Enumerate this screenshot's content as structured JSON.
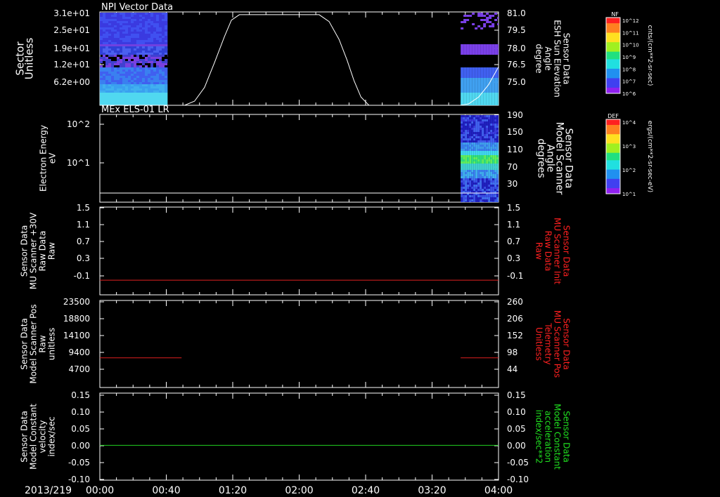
{
  "figure": {
    "date_label": "2013/219",
    "time_ticks": [
      "00:00",
      "00:40",
      "01:20",
      "02:00",
      "02:40",
      "03:20",
      "04:00"
    ],
    "time_range_hours": [
      0,
      4
    ]
  },
  "colorbars": [
    {
      "title": "NF",
      "unit_label": "cnts/(cm**2-sr-sec)",
      "tick_labels": [
        "10^12",
        "10^11",
        "10^10",
        "10^9",
        "10^8",
        "10^7",
        "10^6"
      ]
    },
    {
      "title": "DEF",
      "unit_label": "ergs/(cm**2-sr-sec-eV)",
      "tick_labels": [
        "10^4",
        "10^3",
        "10^2",
        "10^1"
      ]
    }
  ],
  "panels": [
    {
      "title": "NPI Vector Data",
      "left_label": [
        "Sector",
        "Unitless"
      ],
      "left_color": "#ffffff",
      "left_ticks": [
        "3.1e+01",
        "2.5e+01",
        "1.9e+01",
        "1.2e+01",
        "6.2e+00"
      ],
      "right_label": [
        "Sensor Data",
        "ESH Sun Elevation",
        "Angle",
        "degree"
      ],
      "right_color": "#ffffff",
      "right_ticks": [
        "81.0",
        "79.5",
        "78.0",
        "76.5",
        "75.0"
      ],
      "trace_color": "#ffffff"
    },
    {
      "title": "MEx ELS-01 LR",
      "left_label": [
        "Electron Energy",
        "eV"
      ],
      "left_color": "#ffffff",
      "left_ticks": [
        "10^2",
        "10^1"
      ],
      "right_label": [
        "Sensor Data",
        "Model Scanner",
        "Angle",
        "degrees"
      ],
      "right_color": "#ffffff",
      "right_ticks": [
        "190",
        "150",
        "110",
        "70",
        "30"
      ],
      "trace_color": "#ffffff"
    },
    {
      "title": "",
      "left_label": [
        "Sensor Data",
        "MU Scanner +30V",
        "Raw Data",
        "Raw"
      ],
      "left_color": "#ffffff",
      "left_ticks": [
        "1.5",
        "1.1",
        "0.7",
        "0.3",
        "-0.1"
      ],
      "right_label": [
        "Sensor Data",
        "MU Scanner Init",
        "Raw Data",
        "Raw"
      ],
      "right_color": "#ff2020",
      "right_ticks": [
        "1.5",
        "1.1",
        "0.7",
        "0.3",
        "-0.1"
      ],
      "trace_color": "#e02020"
    },
    {
      "title": "",
      "left_label": [
        "Sensor Data",
        "Model Scanner Pos",
        "Raw",
        "unitless"
      ],
      "left_color": "#ffffff",
      "left_ticks": [
        "23500",
        "18800",
        "14100",
        "9400",
        "4700"
      ],
      "right_label": [
        "Sensor Data",
        "MU Scanner Pos",
        "Telemetry",
        "Unitless"
      ],
      "right_color": "#ff2020",
      "right_ticks": [
        "260",
        "206",
        "152",
        "98",
        "44"
      ],
      "trace_color": "#e02020"
    },
    {
      "title": "",
      "left_label": [
        "Sensor Data",
        "Model Constant",
        "velocity",
        "index/sec"
      ],
      "left_color": "#ffffff",
      "left_ticks": [
        "0.15",
        "0.10",
        "0.05",
        "0.00",
        "-0.05",
        "-0.10"
      ],
      "right_label": [
        "Sensor Data",
        "Model Constant",
        "acceleration",
        "index/sec**2"
      ],
      "right_color": "#20e020",
      "right_ticks": [
        "0.15",
        "0.10",
        "0.05",
        "0.00",
        "-0.05",
        "-0.10"
      ],
      "trace_color": "#20d020"
    }
  ],
  "chart_data": [
    {
      "type": "heatmap",
      "title": "NPI Vector Data",
      "ylabel": "Sector Unitless",
      "y2label": "Sensor Data ESH Sun Elevation Angle degree",
      "ylim": [
        0,
        31
      ],
      "y2lim": [
        74.2,
        81.0
      ],
      "heatmap_intervals_hours": [
        [
          0.0,
          0.68
        ],
        [
          3.62,
          4.0
        ]
      ],
      "line_series": {
        "name": "Sensor Data ESH Sun Elevation Angle degree",
        "x_hours": [
          0.0,
          0.85,
          0.95,
          1.05,
          1.15,
          1.25,
          1.32,
          1.4,
          2.2,
          2.3,
          2.4,
          2.48,
          2.55,
          2.62,
          2.7,
          3.62,
          3.7,
          3.8,
          3.9,
          4.0
        ],
        "values": [
          74.2,
          74.2,
          74.5,
          75.5,
          77.3,
          79.2,
          80.4,
          80.8,
          80.8,
          80.3,
          79.0,
          77.5,
          76.0,
          74.8,
          74.2,
          74.2,
          74.3,
          74.8,
          75.7,
          77.0
        ]
      }
    },
    {
      "type": "heatmap",
      "title": "MEx ELS-01 LR",
      "ylabel": "Electron Energy eV",
      "y2label": "Sensor Data Model Scanner Angle degrees",
      "ylim": [
        1,
        200
      ],
      "ylog": true,
      "y2lim": [
        10,
        190
      ],
      "heatmap_intervals_hours": [
        [
          3.62,
          4.0
        ]
      ],
      "line_series": {
        "name": "Sensor Data Model Scanner Angle degrees",
        "x_hours": [
          0,
          4
        ],
        "values": [
          10,
          10
        ]
      }
    },
    {
      "type": "line",
      "ylabel": "Sensor Data MU Scanner +30V Raw Data Raw",
      "y2label": "Sensor Data MU Scanner Init Raw Data Raw",
      "ylim": [
        -0.3,
        1.5
      ],
      "series": [
        {
          "name": "Sensor Data MU Scanner Init Raw Data Raw",
          "x_hours": [
            0,
            4
          ],
          "values": [
            0.0,
            0.0
          ]
        }
      ]
    },
    {
      "type": "line",
      "ylabel": "Sensor Data Model Scanner Pos Raw unitless",
      "y2label": "Sensor Data MU Scanner Pos Telemetry Unitless",
      "ylim": [
        0,
        23500
      ],
      "series": [
        {
          "name": "Sensor Data MU Scanner Pos Telemetry Unitless",
          "segments": [
            {
              "x_hours": [
                0,
                0.82
              ],
              "values": [
                8000,
                8000
              ]
            },
            {
              "x_hours": [
                3.62,
                4.0
              ],
              "values": [
                8000,
                8000
              ]
            }
          ]
        }
      ]
    },
    {
      "type": "line",
      "ylabel": "Sensor Data Model Constant velocity index/sec",
      "y2label": "Sensor Data Model Constant acceleration index/sec**2",
      "ylim": [
        -0.1,
        0.15
      ],
      "series": [
        {
          "name": "Sensor Data Model Constant acceleration index/sec**2",
          "x_hours": [
            0,
            4
          ],
          "values": [
            0.0,
            0.0
          ]
        }
      ]
    }
  ]
}
